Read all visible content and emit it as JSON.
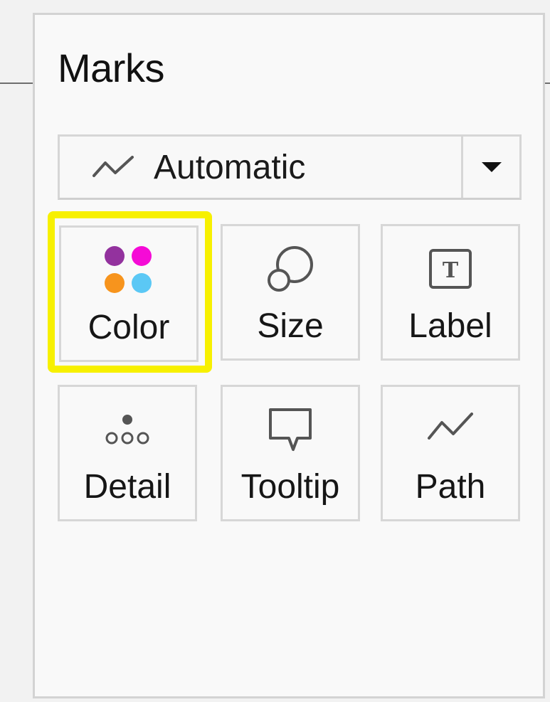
{
  "panel": {
    "title": "Marks"
  },
  "mark_type": {
    "icon": "line-chart-icon",
    "selected": "Automatic"
  },
  "cards": [
    {
      "label": "Color",
      "icon": "color-dots-icon",
      "highlighted": true
    },
    {
      "label": "Size",
      "icon": "size-circles-icon"
    },
    {
      "label": "Label",
      "icon": "text-label-icon"
    },
    {
      "label": "Detail",
      "icon": "detail-dots-icon"
    },
    {
      "label": "Tooltip",
      "icon": "speech-bubble-icon"
    },
    {
      "label": "Path",
      "icon": "path-line-icon"
    }
  ],
  "colors": {
    "highlight": "#f7f000",
    "dot_purple": "#93329e",
    "dot_magenta": "#f50bd6",
    "dot_orange": "#f7941d",
    "dot_blue": "#5bc8f5"
  }
}
